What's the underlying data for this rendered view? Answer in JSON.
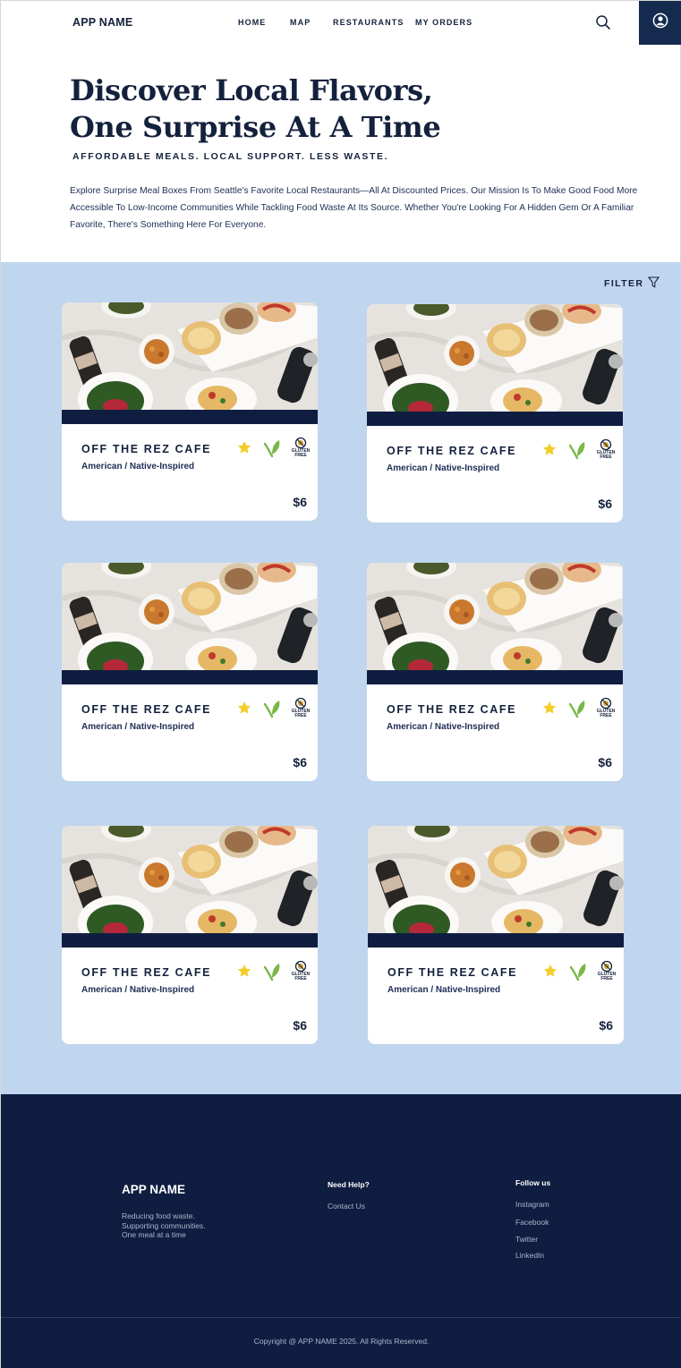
{
  "header": {
    "app_name": "APP NAME",
    "nav": [
      "HOME",
      "MAP",
      "RESTAURANTS",
      "MY ORDERS"
    ]
  },
  "hero": {
    "title_line1": "Discover Local Flavors,",
    "title_line2": "One Surprise At A Time",
    "tagline": "AFFORDABLE MEALS. LOCAL SUPPORT. LESS WASTE.",
    "intro": "Explore Surprise Meal Boxes From Seattle's Favorite Local Restaurants—All At Discounted Prices. Our Mission Is To Make Good Food More Accessible To Low-Income Communities While Tackling Food Waste At Its Source. Whether You're Looking For A Hidden Gem Or A Familiar Favorite, There's Something Here For Everyone."
  },
  "listing": {
    "filter_label": "FILTER",
    "cards": [
      {
        "name": "OFF THE REZ CAFE",
        "cuisine": "American / Native-Inspired",
        "price": "$6",
        "badge_text": "GLUTEN FREE"
      },
      {
        "name": "OFF THE REZ CAFE",
        "cuisine": "American / Native-Inspired",
        "price": "$6",
        "badge_text": "GLUTEN FREE"
      },
      {
        "name": "OFF THE REZ CAFE",
        "cuisine": "American / Native-Inspired",
        "price": "$6",
        "badge_text": "GLUTEN FREE"
      },
      {
        "name": "OFF THE REZ CAFE",
        "cuisine": "American / Native-Inspired",
        "price": "$6",
        "badge_text": "GLUTEN FREE"
      },
      {
        "name": "OFF THE REZ CAFE",
        "cuisine": "American / Native-Inspired",
        "price": "$6",
        "badge_text": "GLUTEN FREE"
      },
      {
        "name": "OFF THE REZ CAFE",
        "cuisine": "American / Native-Inspired",
        "price": "$6",
        "badge_text": "GLUTEN FREE"
      }
    ]
  },
  "footer": {
    "app_name": "APP NAME",
    "mission": [
      "Reducing food waste.",
      "Supporting communities.",
      "One meal at a time"
    ],
    "help_heading": "Need Help?",
    "help_links": [
      "Contact Us"
    ],
    "follow_heading": "Follow us",
    "follow_links": [
      "Instagram",
      "Facebook",
      "Twitter",
      "LinkedIn"
    ],
    "copyright": "Copyright @ APP NAME 2025. All Rights Reserved."
  },
  "colors": {
    "navy": "#0f1d40",
    "text_navy": "#14213d",
    "listing_bg": "#c0d5ee",
    "star": "#f3cd2a",
    "leaf": "#7ab648"
  },
  "icons": [
    "search-icon",
    "user-circle-icon",
    "filter-icon",
    "star-icon",
    "leaf-icon",
    "gluten-free-icon"
  ]
}
